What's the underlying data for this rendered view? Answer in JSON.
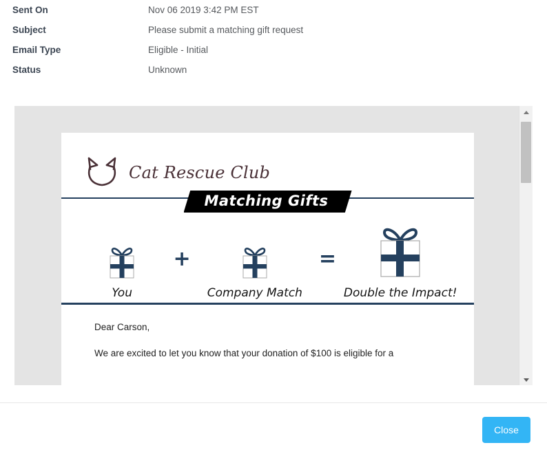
{
  "metadata": {
    "rows": [
      {
        "label": "Sent On",
        "value": "Nov 06 2019 3:42 PM EST"
      },
      {
        "label": "Subject",
        "value": "Please submit a matching gift request"
      },
      {
        "label": "Email Type",
        "value": "Eligible - Initial"
      },
      {
        "label": "Status",
        "value": "Unknown"
      }
    ]
  },
  "email_preview": {
    "brand": {
      "logo_icon": "cat-head-icon",
      "name": "Cat Rescue Club",
      "logo_color": "#4a3137"
    },
    "banner": {
      "text": "Matching Gifts",
      "background": "#000000",
      "text_color": "#ffffff"
    },
    "rule_color": "#24405e",
    "gifts": [
      {
        "icon": "gift-box-icon",
        "label": "You"
      },
      {
        "icon": "gift-box-icon",
        "label": "Company Match"
      },
      {
        "icon": "gift-box-icon",
        "label": "Double the Impact!"
      }
    ],
    "operators": {
      "plus": "+",
      "equals": "="
    },
    "body": {
      "greeting": "Dear Carson,",
      "paragraph1": "We are excited to let you know that your donation of $100 is eligible for a"
    }
  },
  "scrollbar": {
    "up_arrow": "scroll-up-icon",
    "down_arrow": "scroll-down-icon"
  },
  "footer": {
    "close_label": "Close",
    "close_color": "#33b5f5"
  }
}
